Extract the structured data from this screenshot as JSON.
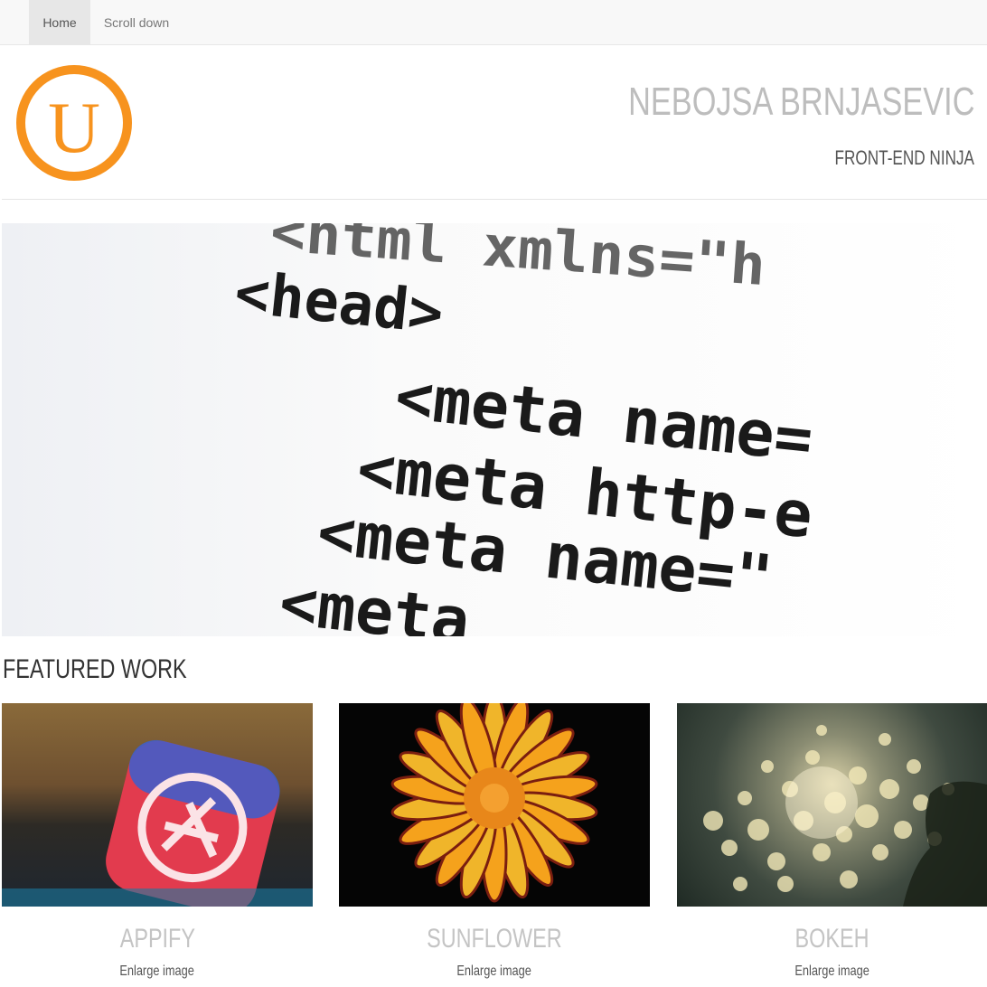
{
  "nav": {
    "home_label": "Home",
    "scroll_label": "Scroll down"
  },
  "header": {
    "logo_letter": "U",
    "title": "NEBOJSA BRNJASEVIC",
    "subtitle": "FRONT-END NINJA"
  },
  "hero": {
    "code_lines": [
      "<html  xmlns=\"h",
      "<head>",
      "<meta  name=",
      "<meta  http-e",
      "<meta  name=\"",
      "<meta"
    ]
  },
  "featured": {
    "heading": "FEATURED WORK",
    "cards": [
      {
        "title": "APPIFY",
        "link": "Enlarge image"
      },
      {
        "title": "SUNFLOWER",
        "link": "Enlarge image"
      },
      {
        "title": "BOKEH",
        "link": "Enlarge image"
      }
    ]
  },
  "colors": {
    "accent": "#f7931e",
    "nav_bg": "#f8f8f8",
    "title_grey": "#bdbdbd"
  }
}
